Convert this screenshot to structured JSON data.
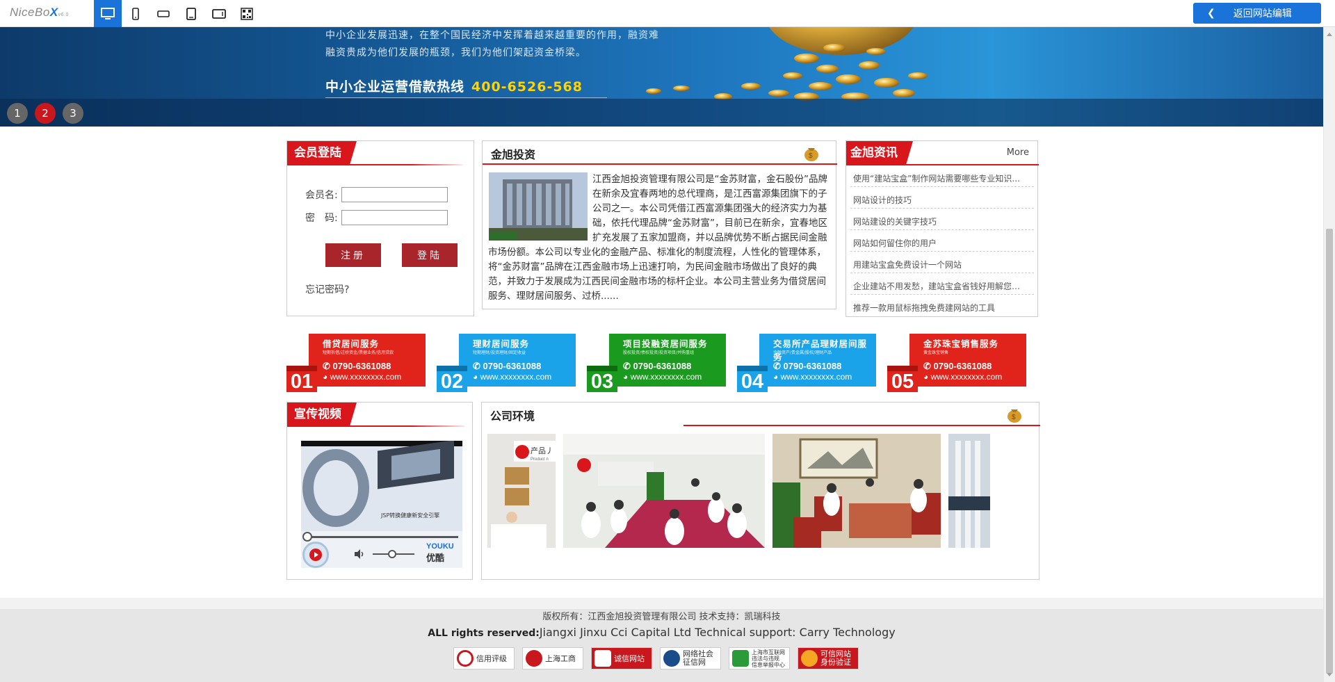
{
  "topbar": {
    "logo_main": "NiceBo",
    "logo_x": "X",
    "logo_ver": "v6.0",
    "devices": [
      "desktop-icon",
      "phone-icon",
      "phone-landscape-icon",
      "tablet-icon",
      "tablet-landscape-icon",
      "qrcode-icon"
    ],
    "back_label": "返回网站编辑",
    "accent": "#1a73d9"
  },
  "banner": {
    "line1": "中小企业发展迅速，在整个国民经济中发挥着越来越重要的作用，融资难",
    "line2": "融资贵成为他们发展的瓶颈，我们为他们架起资金桥梁。",
    "hotline_label": "中小企业运营借款热线",
    "hotline_number": "400-6526-568",
    "slides": [
      "1",
      "2",
      "3"
    ],
    "active_slide": 2
  },
  "login": {
    "title": "会员登陆",
    "username_label": "会员名:",
    "password_label": "密　码:",
    "register_label": "注册",
    "login_label": "登陆",
    "forgot_label": "忘记密码?"
  },
  "about": {
    "title": "金旭投资",
    "text": "江西金旭投资管理有限公司是“金苏财富，金石股份”品牌在新余及宜春两地的总代理商，是江西富源集团旗下的子公司之一。本公司凭借江西富源集团强大的经济实力为基础，依托代理品牌“金苏财富”，目前已在新余，宜春地区扩充发展了五家加盟商，并以品牌优势不断占据民间金融市场份额。本公司以专业化的金融产品、标准化的制度流程，人性化的管理体系，将“金苏财富”品牌在江西金融市场上迅速打响，为民间金融市场做出了良好的典范，并致力于发展成为江西民间金融市场的标杆企业。本公司主营业务为借贷居间服务、理财居间服务、过桥......"
  },
  "news": {
    "title": "金旭资讯",
    "more": "More",
    "items": [
      "使用“建站宝盒”制作网站需要哪些专业知识...",
      "网站设计的技巧",
      "网站建设的关键字技巧",
      "网站如何留住你的用户",
      "用建站宝盒免费设计一个网站",
      "企业建站不用发愁，建站宝盒省钱好用解您忧...",
      "推荐一款用鼠标拖拽免费建网站的工具"
    ]
  },
  "services": [
    {
      "num": "01",
      "name": "借贷居间服务",
      "sub": "短期拆借/过桥资金/票据业务/信用贷款",
      "phone": "0790-6361088",
      "www": "www.xxxxxxxx.com",
      "color": "#e0231b",
      "dark": "#a8150f"
    },
    {
      "num": "02",
      "name": "理财居间服务",
      "sub": "短期理财/投资理财/固定收益",
      "phone": "0790-6361088",
      "www": "www.xxxxxxxx.com",
      "color": "#1aa3e8",
      "dark": "#0b72aa"
    },
    {
      "num": "03",
      "name": "项目投融资居间服务",
      "sub": "股权投资/债权投资/投资项目/并购重组",
      "phone": "0790-6361088",
      "www": "www.xxxxxxxx.com",
      "color": "#1a9a1e",
      "dark": "#0d6b10"
    },
    {
      "num": "04",
      "name": "交易所产品理财居间服务",
      "sub": "金融资产/贵金属/股权/理财产品",
      "phone": "0790-6361088",
      "www": "www.xxxxxxxx.com",
      "color": "#1aa3e8",
      "dark": "#0b72aa"
    },
    {
      "num": "05",
      "name": "金苏珠宝销售服务",
      "sub": "黄金珠宝销售",
      "phone": "0790-6361088",
      "www": "www.xxxxxxxx.com",
      "color": "#e0231b",
      "dark": "#a8150f"
    }
  ],
  "video": {
    "title": "宣传视频",
    "caption": "JSP转换健康新安全引擎",
    "brand_en": "YOUKU",
    "brand_cn": "优酷"
  },
  "environment": {
    "title": "公司环境",
    "sign_text": "产品丿",
    "sign_sub": "Product n"
  },
  "footer": {
    "copyright": "版权所有：江西金旭投资管理有限公司  技术支持：凯瑞科技",
    "rights_label": "ALL rights reserved:",
    "rights_text": "Jiangxi Jinxu Cci Capital Ltd   Technical support: Carry Technology",
    "badges": [
      "信用评级",
      "上海工商",
      "诚信网站",
      "网络社会\n征信网",
      "上海市互联网\n违法与违规\n信息举报中心",
      "可信网站\n身份验证"
    ]
  }
}
